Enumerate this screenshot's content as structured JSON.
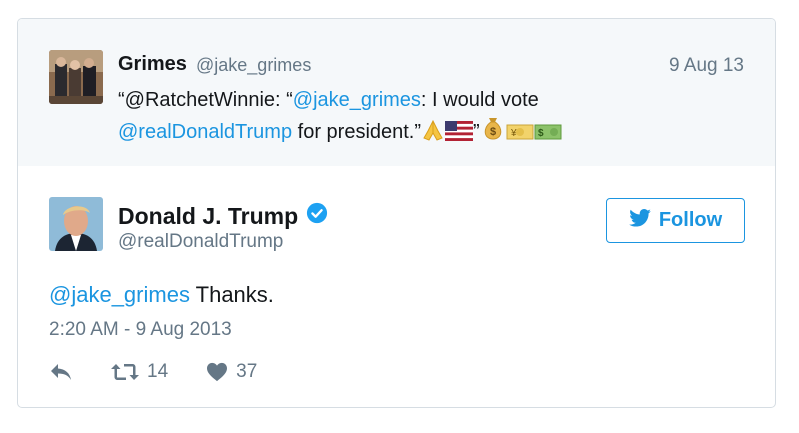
{
  "quoted_tweet": {
    "name": "Grimes",
    "handle": "@jake_grimes",
    "date": "9 Aug 13",
    "text_open": "“@RatchetWinnie: “",
    "mention_1": "@jake_grimes",
    "text_mid": ": I would vote",
    "mention_2": "@realDonaldTrump",
    "text_end": " for president.”",
    "emojis": [
      "folded-hands",
      "us-flag",
      "quote",
      "money-bag",
      "yen-banknote",
      "dollar-banknote"
    ],
    "emoji_quote": "”"
  },
  "tweet": {
    "name": "Donald J. Trump",
    "handle": "@realDonaldTrump",
    "mention": "@jake_grimes",
    "text": " Thanks.",
    "timestamp": "2:20 AM - 9 Aug 2013",
    "retweets": "14",
    "likes": "37"
  },
  "follow_button": {
    "label": "Follow"
  },
  "colors": {
    "link": "#1b95e0",
    "muted": "#657786",
    "verified": "#1da1f2",
    "parent_bg": "#f5f8fa"
  }
}
